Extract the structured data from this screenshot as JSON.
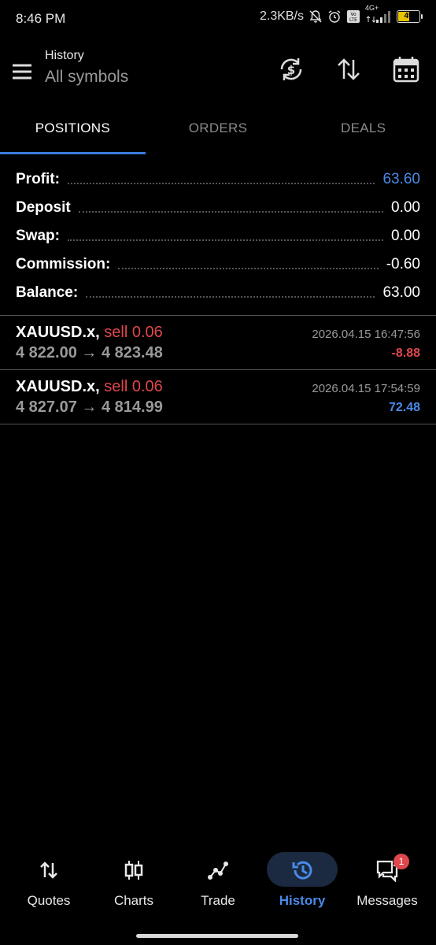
{
  "status_bar": {
    "time": "8:46 PM",
    "network_speed": "2.3KB/s",
    "network_type": "4G+",
    "battery": "49"
  },
  "header": {
    "subtitle": "History",
    "title": "All symbols"
  },
  "tabs": [
    {
      "label": "POSITIONS",
      "active": true
    },
    {
      "label": "ORDERS",
      "active": false
    },
    {
      "label": "DEALS",
      "active": false
    }
  ],
  "summary": [
    {
      "label": "Profit:",
      "value": "63.60"
    },
    {
      "label": "Deposit",
      "value": "0.00"
    },
    {
      "label": "Swap:",
      "value": "0.00"
    },
    {
      "label": "Commission:",
      "value": "-0.60"
    },
    {
      "label": "Balance:",
      "value": "63.00"
    }
  ],
  "deals": [
    {
      "symbol": "XAUUSD.x,",
      "side": "sell 0.06",
      "prices": "4 822.00 → 4 823.48",
      "time": "2026.04.15 16:47:56",
      "profit": "-8.88"
    },
    {
      "symbol": "XAUUSD.x,",
      "side": "sell 0.06",
      "prices": "4 827.07 → 4 814.99",
      "time": "2026.04.15 17:54:59",
      "profit": "72.48"
    }
  ],
  "bottom_nav": [
    {
      "label": "Quotes",
      "icon": "arrows-updown-icon"
    },
    {
      "label": "Charts",
      "icon": "candlestick-icon"
    },
    {
      "label": "Trade",
      "icon": "trade-line-icon"
    },
    {
      "label": "History",
      "icon": "history-icon",
      "active": true
    },
    {
      "label": "Messages",
      "icon": "messages-icon",
      "badge": "1"
    }
  ],
  "colors": {
    "accent": "#4a8ae8",
    "tab_indicator": "#3b7ddd",
    "negative": "#e0474c",
    "background": "#000000"
  }
}
